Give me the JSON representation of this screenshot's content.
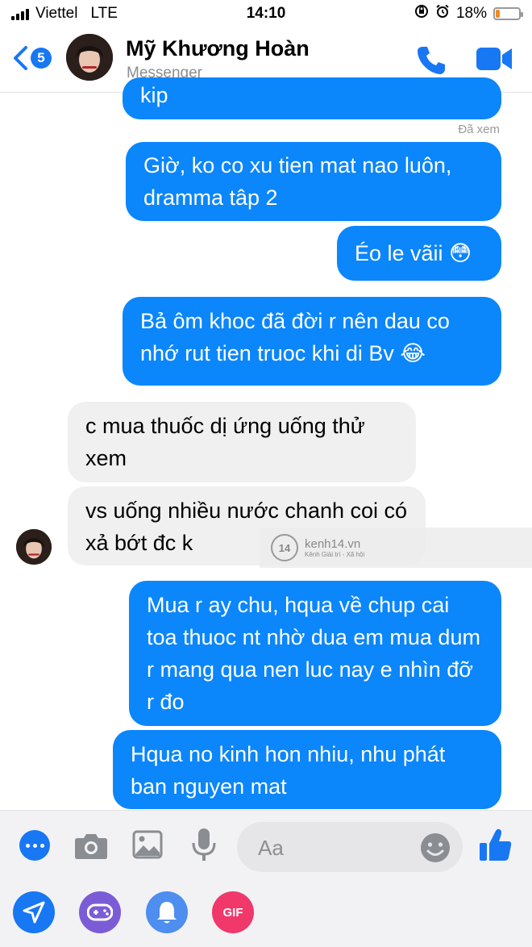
{
  "status_bar": {
    "carrier": "Viettel",
    "network": "LTE",
    "time": "14:10",
    "battery": "18%",
    "battery_level": 0.18,
    "battery_color": "#f08a24"
  },
  "header": {
    "back_count": "5",
    "name": "Mỹ Khương Hoàn",
    "subtitle": "Messenger"
  },
  "messages": [
    {
      "side": "out",
      "text": "kip"
    },
    {
      "side": "out",
      "text": "Giờ, ko co xu tien mat nao luôn, dramma tâp 2"
    },
    {
      "side": "out",
      "text": "Éo le vãii 😳"
    },
    {
      "side": "out",
      "text": "Bả ôm khoc đã đời r nên dau co nhớ rut tien truoc khi di Bv 😂"
    },
    {
      "side": "in",
      "text": "c mua thuốc dị ứng uống thử xem"
    },
    {
      "side": "in",
      "text": "vs uống nhiều nước chanh coi có xả bớt đc k"
    },
    {
      "side": "out",
      "text": "Mua r ay chu, hqua về chup cai toa thuoc nt nhờ dua em mua dum r mang qua nen luc nay e nhìn đỡ r đo"
    },
    {
      "side": "out",
      "text": "Hqua no kinh hon nhiu, nhu phát ban nguyen mat"
    }
  ],
  "seen_label": "Đã xem",
  "watermark": {
    "logo": "14",
    "site": "kenh14.vn",
    "tagline": "Kênh Giải trí - Xã hội"
  },
  "composer": {
    "placeholder": "Aa"
  },
  "tray": {
    "gif_label": "GIF"
  },
  "colors": {
    "accent": "#1877f2",
    "outgoing_bubble": "#0b86fb",
    "incoming_bubble": "#f0f0f0",
    "game": "#7b5cd6",
    "bell": "#4d8ef0",
    "gif": "#f0386b"
  }
}
